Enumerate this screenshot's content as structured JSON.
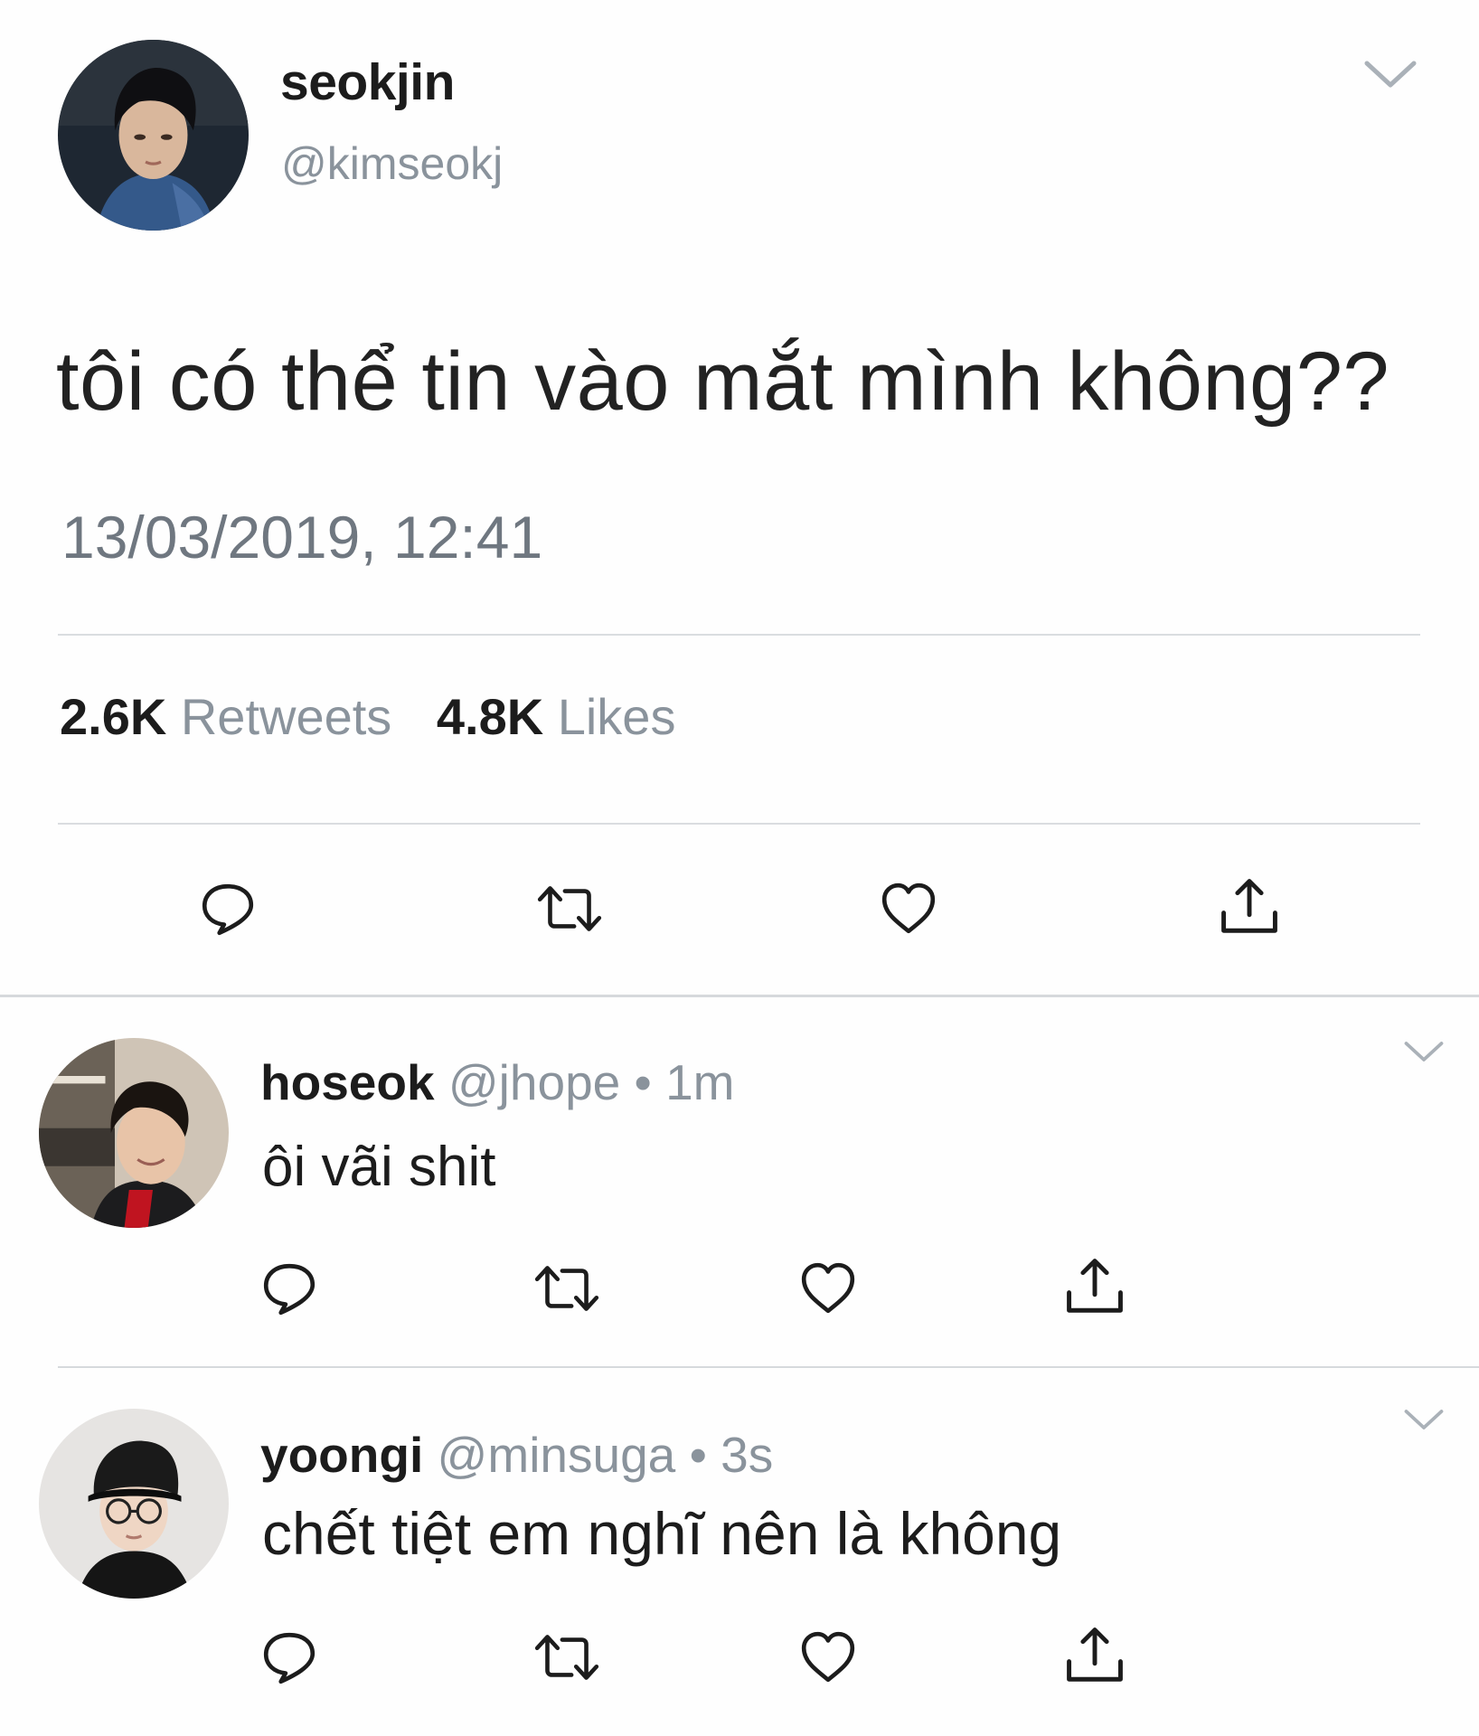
{
  "main_tweet": {
    "display_name": "seokjin",
    "handle": "@kimseokj",
    "text": "tôi có thể tin vào mắt mình không??",
    "timestamp": "13/03/2019, 12:41",
    "retweets_count": "2.6K",
    "retweets_label": "Retweets",
    "likes_count": "4.8K",
    "likes_label": "Likes",
    "actions": [
      "reply-icon",
      "retweet-icon",
      "like-icon",
      "share-icon"
    ]
  },
  "replies": [
    {
      "display_name": "hoseok",
      "handle": "@jhope",
      "separator": "•",
      "time": "1m",
      "text": "ôi vãi shit"
    },
    {
      "display_name": "yoongi",
      "handle": "@minsuga",
      "separator": "•",
      "time": "3s",
      "text": "chết tiệt em nghĩ nên là không"
    }
  ],
  "colors": {
    "text_primary": "#1c1c1c",
    "text_secondary": "#8a939c",
    "icon": "#1c1c1c",
    "divider": "#dadde0"
  }
}
